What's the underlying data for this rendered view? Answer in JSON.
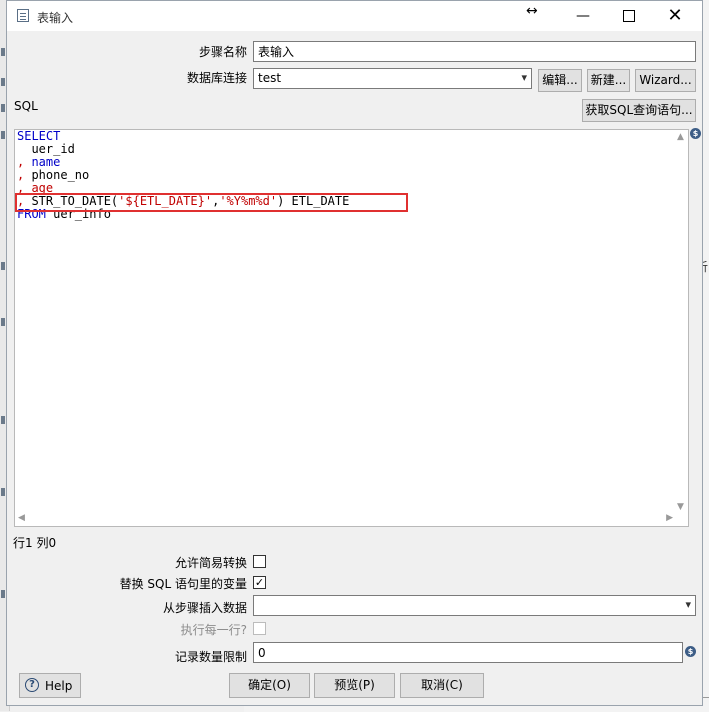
{
  "window": {
    "title": "表输入",
    "close_glyph": "✕",
    "minimize_glyph": "—",
    "resize_glyph": "↔"
  },
  "form": {
    "step_name_label": "步骤名称",
    "step_name_value": "表输入",
    "db_conn_label": "数据库连接",
    "db_conn_value": "test",
    "edit_button": "编辑...",
    "new_button": "新建...",
    "wizard_button": "Wizard...",
    "sql_label": "SQL",
    "get_sql_button": "获取SQL查询语句..."
  },
  "sql_editor": {
    "lines": [
      [
        {
          "t": "SELECT",
          "c": "kw"
        }
      ],
      [
        {
          "t": "  uer_id",
          "c": "plain"
        }
      ],
      [
        {
          "t": ", ",
          "c": "cm"
        },
        {
          "t": "name",
          "c": "kw"
        }
      ],
      [
        {
          "t": ", ",
          "c": "cm"
        },
        {
          "t": "phone_no",
          "c": "plain"
        }
      ],
      [
        {
          "t": ", ",
          "c": "cm"
        },
        {
          "t": "age",
          "c": "cm"
        }
      ],
      [
        {
          "t": ", ",
          "c": "cm"
        },
        {
          "t": "STR_TO_DATE(",
          "c": "plain"
        },
        {
          "t": "'${ETL_DATE}'",
          "c": "str"
        },
        {
          "t": ",",
          "c": "plain"
        },
        {
          "t": "'%Y%m%d'",
          "c": "str"
        },
        {
          "t": ") ETL_DATE",
          "c": "plain"
        }
      ],
      [
        {
          "t": "FROM ",
          "c": "kw"
        },
        {
          "t": "uer_info",
          "c": "plain"
        }
      ]
    ]
  },
  "status": {
    "position_text": "行1 列0"
  },
  "options": {
    "lazy_conversion_label": "允许简易转换",
    "lazy_conversion_checked": false,
    "replace_vars_label": "替换 SQL 语句里的变量",
    "replace_vars_checked": true,
    "insert_from_step_label": "从步骤插入数据",
    "insert_from_step_value": "",
    "execute_each_row_label": "执行每一行?",
    "execute_each_row_checked": false,
    "limit_label": "记录数量限制",
    "limit_value": "0"
  },
  "footer": {
    "help_label": "Help",
    "ok_label": "确定(O)",
    "preview_label": "预览(P)",
    "cancel_label": "取消(C)"
  },
  "background": {
    "right_char": "析"
  },
  "colors": {
    "keyword": "#0000c8",
    "string": "#c00000",
    "highlight_box": "#e03030"
  }
}
